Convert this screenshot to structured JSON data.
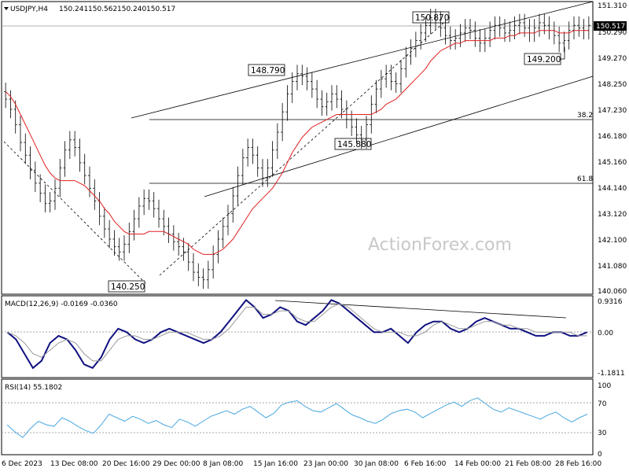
{
  "header": {
    "symbol": "USDJPY,H4",
    "open": "150.241",
    "high": "150.562",
    "low": "150.240",
    "close": "150.517"
  },
  "watermark": "ActionForex.com",
  "chart_data": [
    {
      "type": "candlestick",
      "title": "USDJPY,H4",
      "ylim": [
        140.06,
        151.31
      ],
      "y_ticks": [
        "151.310",
        "150.290",
        "149.270",
        "148.250",
        "147.230",
        "146.180",
        "145.160",
        "144.140",
        "143.120",
        "142.100",
        "141.080",
        "140.060"
      ],
      "x_ticks": [
        "6 Dec 2023",
        "13 Dec 08:00",
        "20 Dec 16:00",
        "29 Dec 00:00",
        "8 Jan 08:00",
        "15 Jan 16:00",
        "23 Jan 00:00",
        "30 Jan 08:00",
        "6 Feb 16:00",
        "14 Feb 00:00",
        "21 Feb 08:00",
        "28 Feb 16:00"
      ],
      "current_price": "150.517",
      "annotations": [
        "150.870",
        "148.790",
        "145.880",
        "149.200",
        "140.250"
      ],
      "fib_levels": [
        {
          "label": "38.2",
          "price": 146.95
        },
        {
          "label": "61.8",
          "price": 144.45
        }
      ],
      "close_series": [
        147.6,
        147.2,
        146.6,
        145.9,
        145.4,
        144.8,
        144.3,
        143.9,
        143.5,
        143.6,
        144.1,
        144.9,
        145.6,
        146.0,
        145.7,
        145.1,
        144.6,
        144.1,
        143.6,
        143.0,
        142.5,
        142.1,
        141.8,
        141.6,
        141.9,
        142.4,
        142.9,
        143.4,
        143.7,
        143.6,
        143.3,
        142.9,
        142.6,
        142.3,
        142.0,
        141.8,
        141.6,
        141.2,
        140.8,
        140.6,
        140.5,
        140.9,
        141.5,
        142.1,
        142.6,
        143.1,
        143.8,
        144.6,
        145.3,
        145.7,
        145.4,
        144.9,
        144.5,
        144.9,
        145.6,
        146.3,
        147.1,
        147.8,
        148.3,
        148.6,
        148.5,
        148.3,
        148.0,
        147.6,
        147.3,
        147.5,
        147.8,
        147.6,
        147.2,
        146.8,
        146.5,
        146.2,
        146.0,
        146.6,
        147.4,
        148.0,
        148.4,
        148.6,
        148.3,
        148.2,
        148.8,
        149.3,
        149.6,
        149.9,
        150.2,
        150.5,
        150.8,
        150.7,
        150.4,
        150.1,
        149.9,
        150.0,
        150.2,
        150.4,
        150.3,
        150.0,
        149.8,
        150.0,
        150.3,
        150.5,
        150.4,
        150.2,
        150.3,
        150.5,
        150.6,
        150.4,
        150.2,
        150.4,
        150.6,
        150.5,
        150.3,
        150.1,
        149.8,
        149.9,
        150.3,
        150.5,
        150.4,
        150.3,
        150.5
      ],
      "ema_series": [
        147.9,
        147.7,
        147.4,
        147.0,
        146.6,
        146.2,
        145.8,
        145.4,
        145.0,
        144.7,
        144.5,
        144.4,
        144.4,
        144.4,
        144.4,
        144.3,
        144.2,
        144.0,
        143.8,
        143.6,
        143.3,
        143.1,
        142.8,
        142.6,
        142.4,
        142.3,
        142.3,
        142.3,
        142.3,
        142.4,
        142.4,
        142.4,
        142.4,
        142.3,
        142.2,
        142.1,
        142.0,
        141.9,
        141.7,
        141.6,
        141.5,
        141.5,
        141.5,
        141.6,
        141.7,
        141.9,
        142.1,
        142.4,
        142.7,
        143.0,
        143.3,
        143.5,
        143.7,
        143.9,
        144.1,
        144.4,
        144.7,
        145.1,
        145.5,
        145.8,
        146.1,
        146.3,
        146.5,
        146.6,
        146.7,
        146.8,
        146.9,
        147.0,
        147.0,
        147.0,
        147.0,
        147.0,
        147.0,
        147.0,
        147.0,
        147.1,
        147.2,
        147.4,
        147.5,
        147.6,
        147.8,
        148.0,
        148.2,
        148.4,
        148.6,
        148.8,
        149.1,
        149.3,
        149.5,
        149.6,
        149.7,
        149.8,
        149.8,
        149.9,
        149.9,
        149.9,
        149.9,
        149.9,
        149.9,
        150.0,
        150.0,
        150.0,
        150.1,
        150.1,
        150.2,
        150.2,
        150.2,
        150.2,
        150.3,
        150.3,
        150.3,
        150.3,
        150.2,
        150.2,
        150.2,
        150.3,
        150.3,
        150.3,
        150.3
      ]
    },
    {
      "type": "line",
      "title": "MACD(12,26,9) -0.0169 -0.0360",
      "ylim": [
        -1.1811,
        0.9316
      ],
      "y_ticks": [
        "0.9316",
        "0.00",
        "-1.1811"
      ],
      "series": [
        {
          "name": "MACD",
          "values": [
            0.0,
            -0.2,
            -0.6,
            -1.0,
            -0.8,
            -0.3,
            -0.1,
            -0.2,
            -0.5,
            -0.9,
            -1.0,
            -0.7,
            -0.2,
            0.1,
            0.0,
            -0.2,
            -0.3,
            -0.2,
            0.0,
            0.1,
            0.0,
            -0.1,
            -0.2,
            -0.3,
            -0.2,
            0.0,
            0.3,
            0.6,
            0.9,
            0.7,
            0.4,
            0.5,
            0.7,
            0.6,
            0.3,
            0.2,
            0.4,
            0.6,
            0.9,
            0.8,
            0.6,
            0.4,
            0.2,
            0.0,
            0.0,
            0.1,
            -0.1,
            -0.3,
            0.0,
            0.2,
            0.3,
            0.3,
            0.1,
            0.0,
            0.1,
            0.3,
            0.4,
            0.3,
            0.2,
            0.1,
            0.1,
            0.0,
            -0.1,
            -0.1,
            0.0,
            0.0,
            -0.1,
            -0.1,
            0.0
          ]
        },
        {
          "name": "Signal",
          "values": [
            0.0,
            -0.1,
            -0.3,
            -0.6,
            -0.7,
            -0.5,
            -0.3,
            -0.2,
            -0.3,
            -0.6,
            -0.8,
            -0.8,
            -0.5,
            -0.2,
            -0.1,
            -0.1,
            -0.2,
            -0.2,
            -0.1,
            0.0,
            0.0,
            0.0,
            -0.1,
            -0.2,
            -0.2,
            -0.1,
            0.1,
            0.4,
            0.7,
            0.7,
            0.5,
            0.5,
            0.6,
            0.6,
            0.4,
            0.3,
            0.3,
            0.5,
            0.7,
            0.8,
            0.7,
            0.5,
            0.3,
            0.1,
            0.0,
            0.0,
            0.0,
            -0.1,
            -0.1,
            0.0,
            0.2,
            0.3,
            0.2,
            0.1,
            0.1,
            0.2,
            0.3,
            0.3,
            0.2,
            0.2,
            0.1,
            0.1,
            0.0,
            0.0,
            0.0,
            0.0,
            0.0,
            -0.1,
            -0.1
          ]
        }
      ]
    },
    {
      "type": "line",
      "title": "RSI(14) 55.1802",
      "ylim": [
        0,
        100
      ],
      "y_ticks": [
        "100",
        "70",
        "30",
        "0"
      ],
      "series": [
        {
          "name": "RSI",
          "values": [
            40,
            30,
            22,
            35,
            45,
            40,
            38,
            50,
            45,
            38,
            32,
            28,
            40,
            55,
            50,
            45,
            52,
            48,
            42,
            46,
            40,
            36,
            48,
            44,
            38,
            45,
            52,
            56,
            60,
            55,
            62,
            66,
            58,
            50,
            56,
            68,
            72,
            74,
            66,
            60,
            58,
            64,
            70,
            62,
            54,
            50,
            45,
            42,
            48,
            56,
            60,
            62,
            58,
            50,
            56,
            62,
            68,
            72,
            66,
            74,
            78,
            70,
            62,
            58,
            64,
            60,
            56,
            52,
            48,
            54,
            58,
            50,
            44,
            50,
            55
          ]
        }
      ]
    }
  ]
}
